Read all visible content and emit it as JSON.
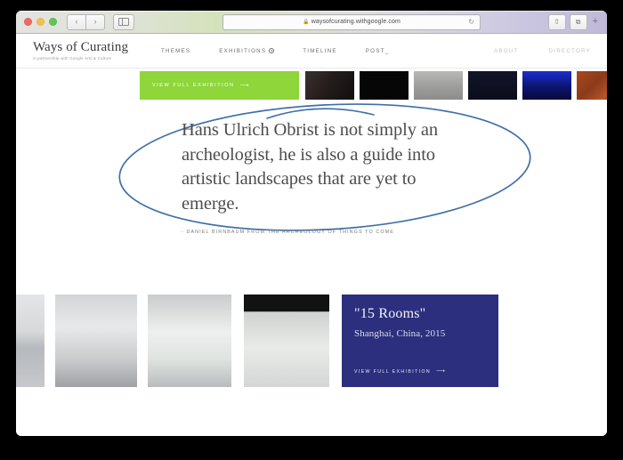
{
  "browser": {
    "url": "waysofcurating.withgoogle.com",
    "lock_icon": "lock-icon",
    "reload_icon": "reload-icon",
    "back_icon": "‹",
    "forward_icon": "›",
    "sidebar_icon": "sidebar-toggle-icon",
    "share_icon": "⇧",
    "tabs_icon": "⧉",
    "newtab_icon": "+"
  },
  "site": {
    "brand": {
      "title": "Ways of Curating",
      "tagline": "in partnership with Google Arts & Culture"
    },
    "nav_left": [
      {
        "label": "THEMES"
      },
      {
        "label": "EXHIBITIONS"
      },
      {
        "label": "TIMELINE"
      },
      {
        "label": "POST_"
      }
    ],
    "nav_right": [
      {
        "label": "ABOUT"
      },
      {
        "label": "DIRECTORY"
      }
    ]
  },
  "top_section": {
    "cta_label": "VIEW FULL EXHIBITION",
    "cta_arrow": "⟶",
    "cta_color": "#8ed63a",
    "thumbnails": [
      {
        "name": "dark-room-thumbnail",
        "style": "linear-gradient(120deg,#3a3230 0%,#241d1c 45%,#120e0e 100%)"
      },
      {
        "name": "black-thumbnail",
        "style": "#060606"
      },
      {
        "name": "gray-floor-thumbnail",
        "style": "linear-gradient(to bottom,#b8b8b6 0%,#9d9d9b 55%,#8c8c8a 100%)"
      },
      {
        "name": "dark-navy-thumbnail",
        "style": "linear-gradient(to bottom,#121528 0%,#0b0d1c 100%)"
      },
      {
        "name": "blue-light-thumbnail",
        "style": "linear-gradient(to bottom,#1b2ed0 0%,#0c1570 55%,#060a3a 100%)"
      },
      {
        "name": "orange-texture-thumbnail",
        "style": "linear-gradient(135deg,#a8491f 0%,#8c3a1a 40%,#b4562a 70%,#7c3016 100%)"
      }
    ]
  },
  "quote_section": {
    "text": "Hans Ulrich Obrist is not simply an archeologist, he is also a guide into artistic landscapes that are yet to emerge.",
    "attribution": "- DANIEL BIRNBAUM FROM THE ARCHEOLOGY OF THINGS TO COME",
    "annotation_color": "#3f6fa8"
  },
  "bottom_section": {
    "thumbnails": [
      {
        "name": "gallery-crowd-thumbnail",
        "style": "linear-gradient(to bottom,#e4e5e7 0%,#d6d8da 40%,#b6b9bd 58%,#c6c8cb 100%)"
      },
      {
        "name": "white-wall-installation-thumbnail",
        "style": "linear-gradient(to bottom,#d2d4d6 0%,#e8e9ea 35%,#c9cbcd 70%,#9fa2a5 100%)"
      },
      {
        "name": "corridor-lights-thumbnail",
        "style": "linear-gradient(to bottom,#c9cbcc 0%,#eef0ef 40%,#dfe3e0 70%,#b9bcbd 100%)"
      },
      {
        "name": "glass-panels-thumbnail",
        "style": "linear-gradient(to bottom,#121212 0%,#121212 18%,#cfd2d0 19%,#e9ebe9 58%,#d3d6d4 100%)"
      }
    ],
    "card": {
      "title": "\"15 Rooms\"",
      "subtitle": "Shanghai, China, 2015",
      "cta_label": "VIEW FULL EXHIBITION",
      "cta_arrow": "⟶",
      "background_color": "#2b2f7e"
    }
  }
}
